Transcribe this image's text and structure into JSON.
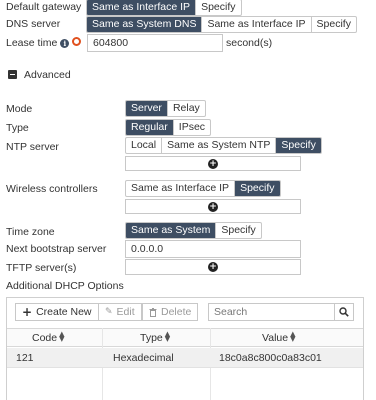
{
  "default_gateway": {
    "label": "Default gateway",
    "options": [
      "Same as Interface IP",
      "Specify"
    ],
    "selected": 0
  },
  "dns_server": {
    "label": "DNS server",
    "options": [
      "Same as System DNS",
      "Same as Interface IP",
      "Specify"
    ],
    "selected": 0
  },
  "lease_time": {
    "label": "Lease time",
    "value": "604800",
    "unit": "second(s)"
  },
  "advanced": {
    "label": "Advanced"
  },
  "mode": {
    "label": "Mode",
    "options": [
      "Server",
      "Relay"
    ],
    "selected": 0
  },
  "type": {
    "label": "Type",
    "options": [
      "Regular",
      "IPsec"
    ],
    "selected": 0
  },
  "ntp_server": {
    "label": "NTP server",
    "options": [
      "Local",
      "Same as System NTP",
      "Specify"
    ],
    "selected": 2
  },
  "wireless_controllers": {
    "label": "Wireless controllers",
    "options": [
      "Same as Interface IP",
      "Specify"
    ],
    "selected": 1
  },
  "time_zone": {
    "label": "Time zone",
    "options": [
      "Same as System",
      "Specify"
    ],
    "selected": 0
  },
  "next_bootstrap_server": {
    "label": "Next bootstrap server",
    "value": "0.0.0.0"
  },
  "tftp_servers": {
    "label": "TFTP server(s)"
  },
  "dhcp_options": {
    "label": "Additional DHCP Options",
    "toolbar": {
      "create_new": "Create New",
      "edit": "Edit",
      "delete": "Delete",
      "search_placeholder": "Search"
    },
    "columns": [
      "Code",
      "Type",
      "Value"
    ],
    "rows": [
      {
        "code": "121",
        "type": "Hexadecimal",
        "value": "18c0a8c800c0a83c01"
      }
    ]
  },
  "colors": {
    "selected_bg": "#3e4e63",
    "toggle_accent": "#e0501e"
  },
  "icons": [
    "info-icon",
    "toggle-icon",
    "collapse-icon",
    "plus-icon",
    "pencil-icon",
    "trash-icon",
    "search-icon",
    "sort-icon"
  ]
}
